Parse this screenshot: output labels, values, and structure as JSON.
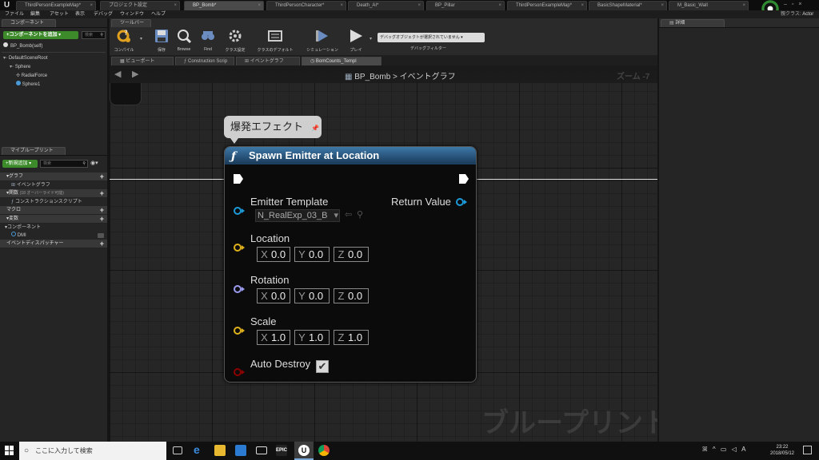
{
  "tabs": [
    {
      "label": "ThirdPersonExampleMap*",
      "active": false
    },
    {
      "label": "プロジェクト設定",
      "active": false
    },
    {
      "label": "BP_Bomb*",
      "active": true
    },
    {
      "label": "ThirdPersonCharacter*",
      "active": false
    },
    {
      "label": "Death_AI*",
      "active": false
    },
    {
      "label": "BP_Pillar",
      "active": false
    },
    {
      "label": "ThirdPersonExampleMap*",
      "active": false
    },
    {
      "label": "BasicShapeMaterial*",
      "active": false
    },
    {
      "label": "M_Basic_Wall",
      "active": false
    }
  ],
  "menu": [
    "ファイル",
    "編集",
    "アセット",
    "表示",
    "デバッグ",
    "ウィンドウ",
    "ヘルプ"
  ],
  "parent_class": {
    "label": "親クラス:",
    "value": "Actor"
  },
  "components": {
    "title": "コンポーネント",
    "add_label": "+コンポーネントを追加 ▾",
    "search_placeholder": "検索",
    "self": "BP_Bomb(self)",
    "tree": [
      "DefaultSceneRoot",
      "Sphere",
      "RadialForce",
      "Sphere1"
    ]
  },
  "myblueprint": {
    "title": "マイブループリント",
    "add_label": "+新規追加 ▾",
    "search_placeholder": "検索",
    "categories": {
      "graph": "グラフ",
      "event_graph": "イベントグラフ",
      "functions": "関数",
      "functions_note": "(18 オーバーライド可能)",
      "construction": "コンストラクションスクリプト",
      "macros": "マクロ",
      "variables": "変数",
      "components": "コンポーネント",
      "dmi": "DMI",
      "dispatchers": "イベントディスパッチャー"
    }
  },
  "toolbar": {
    "title": "ツールバー",
    "buttons": [
      {
        "label": "コンパイル",
        "icon": "compile-icon"
      },
      {
        "label": "保存",
        "icon": "save-icon"
      },
      {
        "label": "Browse",
        "icon": "browse-icon"
      },
      {
        "label": "Find",
        "icon": "find-icon"
      },
      {
        "label": "クラス設定",
        "icon": "class-settings-icon"
      },
      {
        "label": "クラスのデフォルト",
        "icon": "class-defaults-icon"
      },
      {
        "label": "シミュレーション",
        "icon": "simulation-icon"
      },
      {
        "label": "プレイ",
        "icon": "play-icon"
      }
    ],
    "debug_select": "デバッグオブジェクトが選択されていません ▾",
    "debug_filter": "デバッグフィルター"
  },
  "graph_tabs": [
    {
      "label": "ビューポート",
      "active": false
    },
    {
      "label": "Construction Scrip",
      "active": false
    },
    {
      "label": "イベントグラフ",
      "active": false
    },
    {
      "label": "BomCounts_Templ",
      "active": true
    }
  ],
  "graph": {
    "breadcrumb_root": "BP_Bomb",
    "breadcrumb_sep": ">",
    "breadcrumb_page": "イベントグラフ",
    "zoom": "ズーム -7",
    "watermark": "ブループリント",
    "comment": "爆発エフェクト",
    "node": {
      "title": "Spawn Emitter at Location",
      "emitter_label": "Emitter Template",
      "emitter_value": "N_RealExp_03_B",
      "return_label": "Return Value",
      "location_label": "Location",
      "location": {
        "x": "0.0",
        "y": "0.0",
        "z": "0.0"
      },
      "rotation_label": "Rotation",
      "rotation": {
        "x": "0.0",
        "y": "0.0",
        "z": "0.0"
      },
      "scale_label": "Scale",
      "scale": {
        "x": "1.0",
        "y": "1.0",
        "z": "1.0"
      },
      "auto_destroy_label": "Auto Destroy",
      "auto_destroy": true,
      "axis": {
        "x": "X",
        "y": "Y",
        "z": "Z"
      }
    }
  },
  "details": {
    "title": "詳細"
  },
  "taskbar": {
    "search_placeholder": "ここに入力して検索",
    "time": "23:22",
    "date": "2018/05/12"
  },
  "colors": {
    "exec": "#ffffff",
    "object_pin": "#1d9ad8",
    "struct_pin": "#e0b21c",
    "rotator_pin": "#9c9cf0",
    "bool_pin": "#8c0000",
    "header": "#2e6a9a"
  }
}
